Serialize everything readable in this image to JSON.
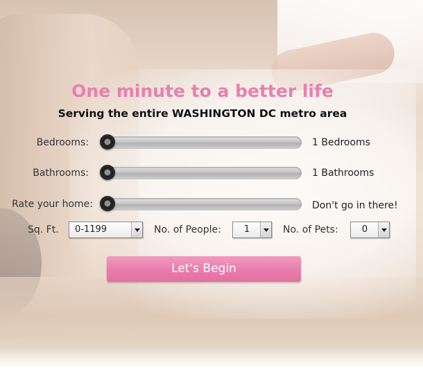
{
  "header": {
    "headline": "One minute to a better life",
    "subhead": "Serving the entire WASHINGTON DC metro area"
  },
  "sliders": [
    {
      "label": "Bedrooms:",
      "value_text": "1 Bedrooms",
      "level": 0
    },
    {
      "label": "Bathrooms:",
      "value_text": "1 Bathrooms",
      "level": 0
    },
    {
      "label": "Rate your home:",
      "value_text": "Don't go in there!",
      "level": 0
    }
  ],
  "selects": {
    "sqft": {
      "label": "Sq. Ft.",
      "value": "0-1199"
    },
    "people": {
      "label": "No. of People:",
      "value": "1"
    },
    "pets": {
      "label": "No. of Pets:",
      "value": "0"
    }
  },
  "cta": {
    "label": "Let's Begin"
  },
  "colors": {
    "accent_pink": "#e97fae",
    "button_pink": "#e97fae",
    "text_dark": "#111111"
  }
}
